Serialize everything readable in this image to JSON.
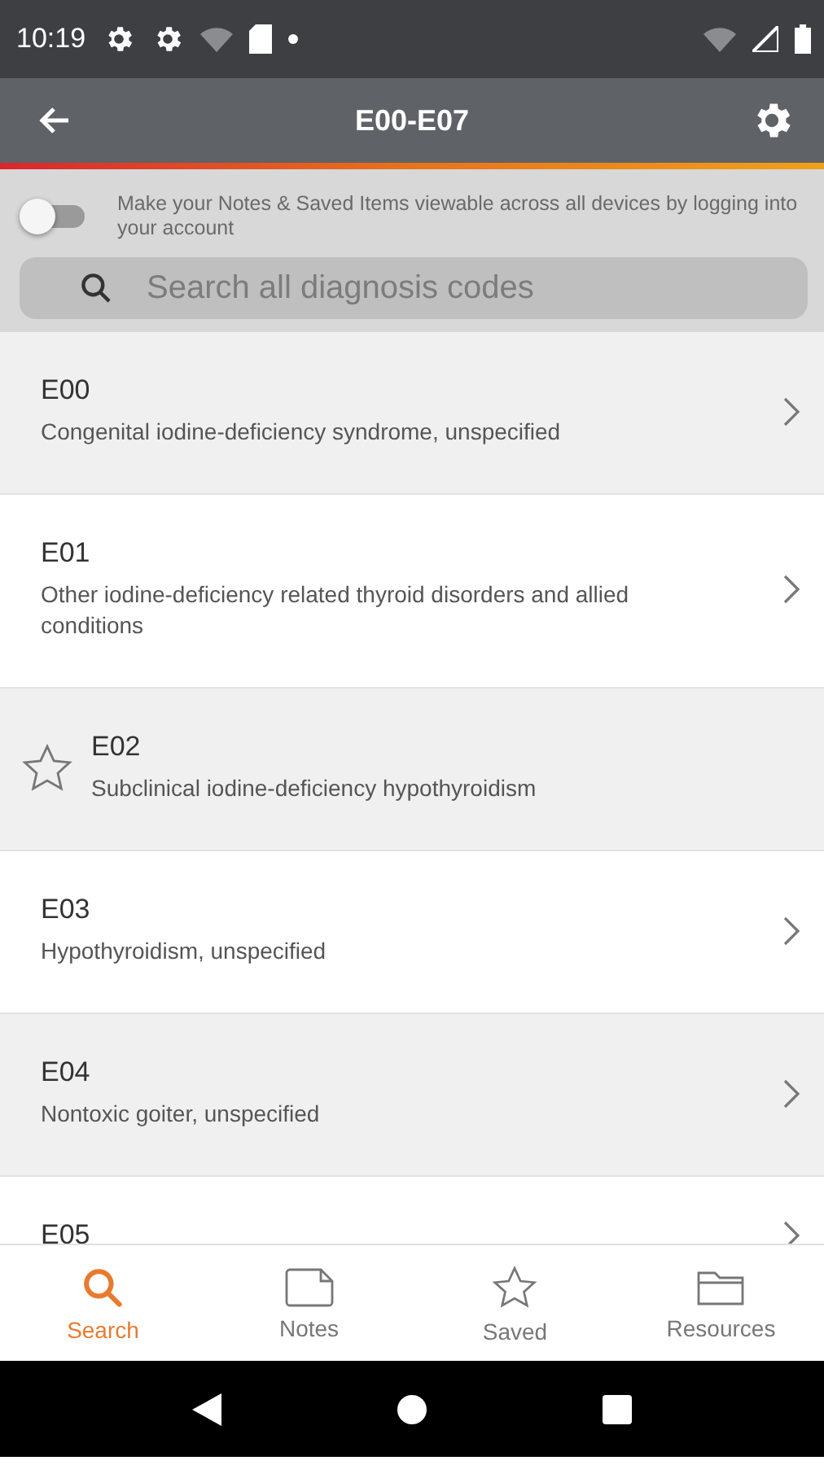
{
  "status_bar": {
    "time": "10:19"
  },
  "app_bar": {
    "title": "E00-E07"
  },
  "sync_banner": {
    "toggle": {
      "on": false
    },
    "message": "Make your Notes & Saved Items viewable across all devices by logging into your account"
  },
  "search": {
    "placeholder": "Search all diagnosis codes"
  },
  "codes": [
    {
      "kind": "chevron",
      "code": "E00",
      "description": "Congenital iodine-deficiency syndrome, unspecified"
    },
    {
      "kind": "chevron",
      "code": "E01",
      "description": "Other iodine-deficiency related thyroid disorders and allied conditions"
    },
    {
      "kind": "star",
      "code": "E02",
      "description": "Subclinical iodine-deficiency hypothyroidism"
    },
    {
      "kind": "chevron",
      "code": "E03",
      "description": "Hypothyroidism, unspecified"
    },
    {
      "kind": "chevron",
      "code": "E04",
      "description": "Nontoxic goiter, unspecified"
    },
    {
      "kind": "chevron",
      "code": "E05"
    }
  ],
  "tabs": [
    {
      "kind": "search",
      "label": "Search",
      "selected": true
    },
    {
      "kind": "notes",
      "label": "Notes",
      "selected": false
    },
    {
      "kind": "saved",
      "label": "Saved",
      "selected": false
    },
    {
      "kind": "resources",
      "label": "Resources",
      "selected": false
    }
  ]
}
